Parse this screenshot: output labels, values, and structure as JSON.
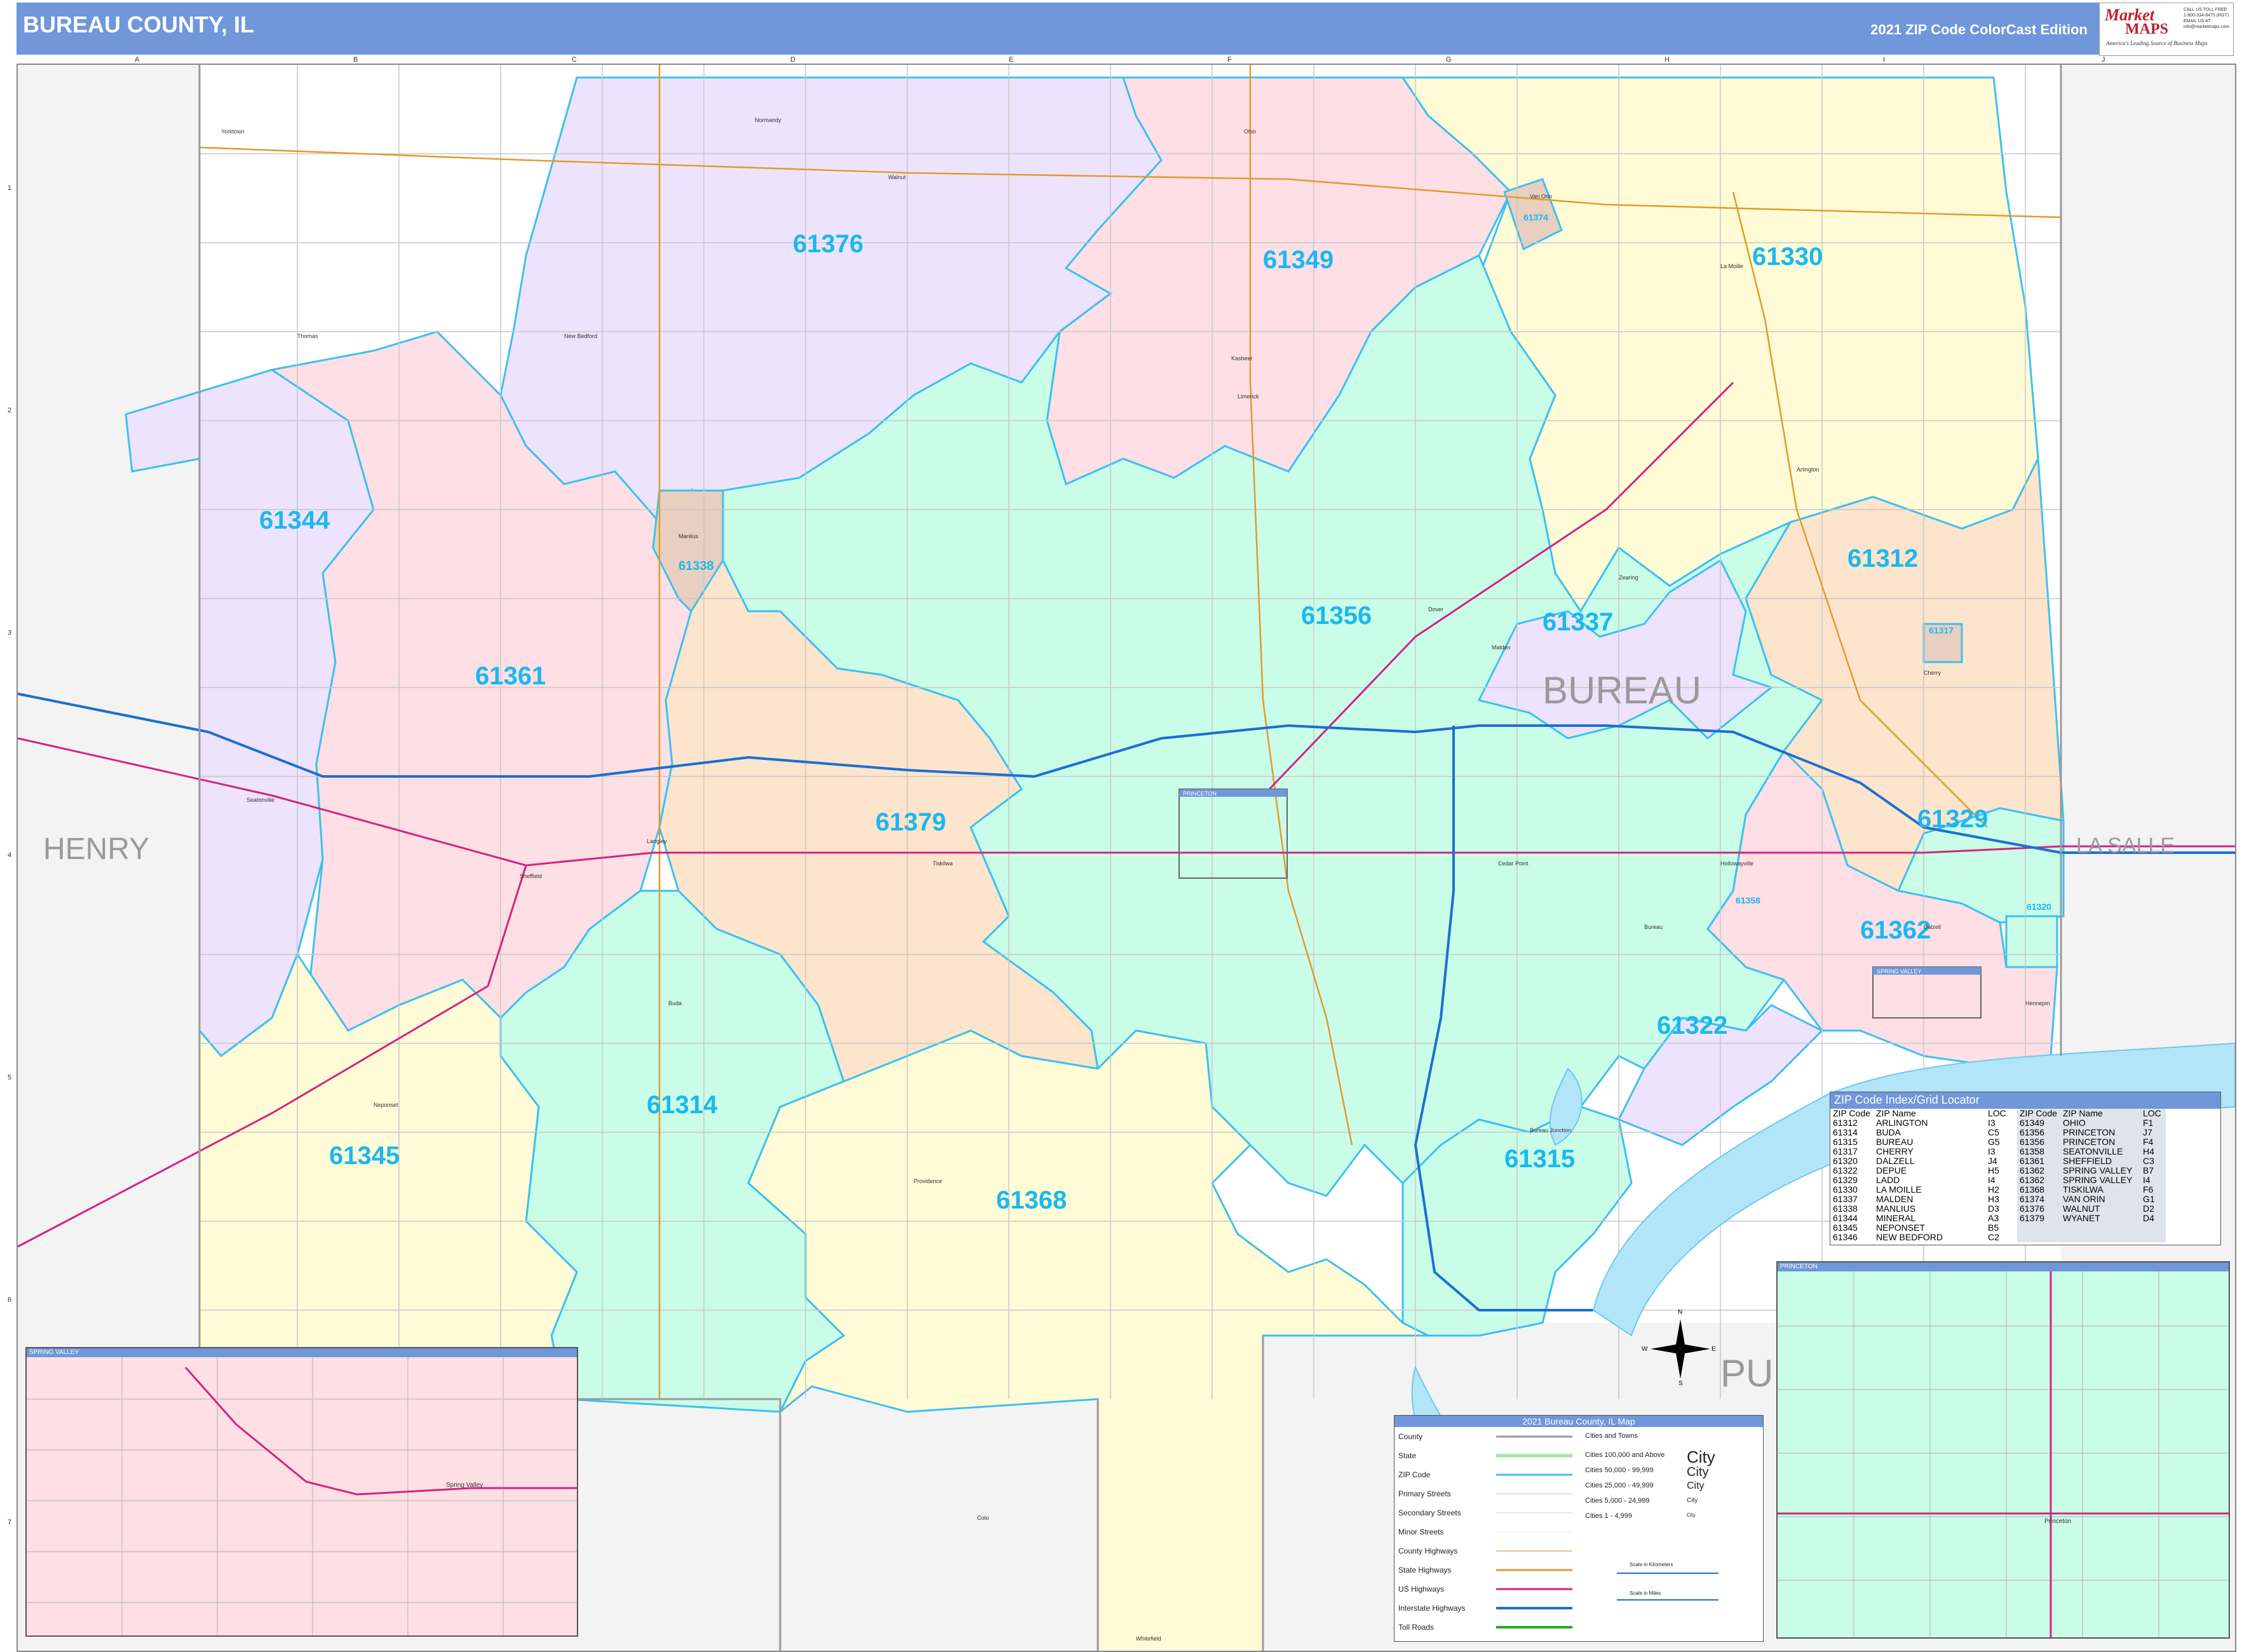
{
  "header": {
    "title": "BUREAU COUNTY, IL",
    "edition": "2021 ZIP Code ColorCast Edition",
    "logo_line1": "Market",
    "logo_line2": "MAPS",
    "logo_tagline": "America's Leading Source of Business Maps",
    "logo_contact": "CALL US TOLL FREE 1-800-334-8475 (RGT) EMAIL US AT info@marketmaps.com"
  },
  "grid": {
    "columns": [
      "A",
      "B",
      "C",
      "D",
      "E",
      "F",
      "G",
      "H",
      "I",
      "J"
    ],
    "rows": [
      "1",
      "2",
      "3",
      "4",
      "5",
      "6",
      "7"
    ]
  },
  "counties": {
    "main": "BUREAU",
    "west": "HENRY",
    "east": "LA SALLE",
    "south_partial": "PU"
  },
  "zips": [
    {
      "code": "61376",
      "color": "#ede3fd"
    },
    {
      "code": "61349",
      "color": "#fddfe5"
    },
    {
      "code": "61330",
      "color": "#fffbd6"
    },
    {
      "code": "61374",
      "color": "#e8cfc0"
    },
    {
      "code": "61344",
      "color": "#ede3fd"
    },
    {
      "code": "61338",
      "color": "#e8cfc0"
    },
    {
      "code": "61312",
      "color": "#fde4cc"
    },
    {
      "code": "61356",
      "color": "#c9fde8"
    },
    {
      "code": "61337",
      "color": "#ede3fd"
    },
    {
      "code": "61317",
      "color": "#e8cfc0"
    },
    {
      "code": "61361",
      "color": "#fddfe5"
    },
    {
      "code": "61379",
      "color": "#fde4cc"
    },
    {
      "code": "61329",
      "color": "#c9fde8"
    },
    {
      "code": "61358",
      "color": "#ede3fd"
    },
    {
      "code": "61320",
      "color": "#c9fde8"
    },
    {
      "code": "61362",
      "color": "#fddfe5"
    },
    {
      "code": "61322",
      "color": "#ede3fd"
    },
    {
      "code": "61314",
      "color": "#c9fde8"
    },
    {
      "code": "61345",
      "color": "#fffbd6"
    },
    {
      "code": "61368",
      "color": "#fffbd6"
    },
    {
      "code": "61315",
      "color": "#c9fde8"
    }
  ],
  "towns": [
    "Yorktown",
    "Normandy",
    "Walnut",
    "Ohio",
    "Van Orin",
    "La Moille",
    "Dover",
    "Thomas",
    "New Bedford",
    "Kasbeer",
    "Limerick",
    "Arlington",
    "Manlius",
    "Dalzell",
    "Malden",
    "Tiskilwa",
    "Princeton",
    "Wyanet",
    "Buda",
    "Neponset",
    "Sheffield",
    "Mineral",
    "Langley",
    "Seatonville",
    "Cherry",
    "Ladd",
    "Spring Valley",
    "Depue",
    "Bureau",
    "Bureau Junction",
    "Hollowayville",
    "Cedar Point",
    "Providence",
    "Zearing",
    "Hennepin",
    "Mineral",
    "Whitefield",
    "Hatteras",
    "Colo",
    "Ladd",
    "Hollowayville"
  ],
  "zip_index": {
    "title": "ZIP Code Index/Grid Locator",
    "headers": [
      "ZIP Code",
      "ZIP Name",
      "LOC",
      "ZIP Code",
      "ZIP Name",
      "LOC"
    ],
    "left": [
      [
        "61312",
        "ARLINGTON",
        "I3"
      ],
      [
        "61314",
        "BUDA",
        "C5"
      ],
      [
        "61315",
        "BUREAU",
        "G5"
      ],
      [
        "61317",
        "CHERRY",
        "I3"
      ],
      [
        "61320",
        "DALZELL",
        "J4"
      ],
      [
        "61322",
        "DEPUE",
        "H5"
      ],
      [
        "61329",
        "LADD",
        "I4"
      ],
      [
        "61330",
        "LA MOILLE",
        "H2"
      ],
      [
        "61337",
        "MALDEN",
        "H3"
      ],
      [
        "61338",
        "MANLIUS",
        "D3"
      ],
      [
        "61344",
        "MINERAL",
        "A3"
      ],
      [
        "61345",
        "NEPONSET",
        "B5"
      ],
      [
        "61346",
        "NEW BEDFORD",
        "C2"
      ]
    ],
    "right": [
      [
        "61349",
        "OHIO",
        "F1"
      ],
      [
        "61356",
        "PRINCETON",
        "J7"
      ],
      [
        "61356",
        "PRINCETON",
        "F4"
      ],
      [
        "61358",
        "SEATONVILLE",
        "H4"
      ],
      [
        "61361",
        "SHEFFIELD",
        "C3"
      ],
      [
        "61362",
        "SPRING VALLEY",
        "B7"
      ],
      [
        "61362",
        "SPRING VALLEY",
        "I4"
      ],
      [
        "61368",
        "TISKILWA",
        "F6"
      ],
      [
        "61374",
        "VAN ORIN",
        "G1"
      ],
      [
        "61376",
        "WALNUT",
        "D2"
      ],
      [
        "61379",
        "WYANET",
        "D4"
      ]
    ]
  },
  "insets": {
    "spring_valley": "SPRING VALLEY",
    "princeton": "PRINCETON",
    "princeton_label": "Princeton",
    "spring_valley_label": "Spring Valley",
    "princeton_marker": "PRINCETON",
    "spring_valley_marker": "SPRING VALLEY"
  },
  "legend": {
    "title": "2021 Bureau County, IL Map",
    "rows": [
      "County",
      "State",
      "ZIP Code",
      "Primary Streets",
      "Secondary Streets",
      "Minor Streets",
      "County Highways",
      "State Highways",
      "US Highways",
      "Interstate Highways",
      "Toll Roads"
    ],
    "cities_header": "Cities and Towns",
    "cities": [
      "Cities 100,000 and Above",
      "Cities 50,000 - 99,999",
      "Cities 25,000 - 49,999",
      "Cities 5,000 - 24,999",
      "Cities 1 - 4,999"
    ],
    "city_word": "City",
    "scale_km": "Scale in Kilometers",
    "scale_mi": "Scale in Miles"
  },
  "compass": {
    "n": "N",
    "s": "S",
    "e": "E",
    "w": "W"
  },
  "colors": {
    "zip_label": "#1ab8ef",
    "zip_border": "#3dc1ee",
    "interstate": "#1c6fd1",
    "us_highway": "#d4237f",
    "state_highway": "#e39a2a",
    "header": "#6f97d9",
    "river": "#b3e5f8"
  }
}
